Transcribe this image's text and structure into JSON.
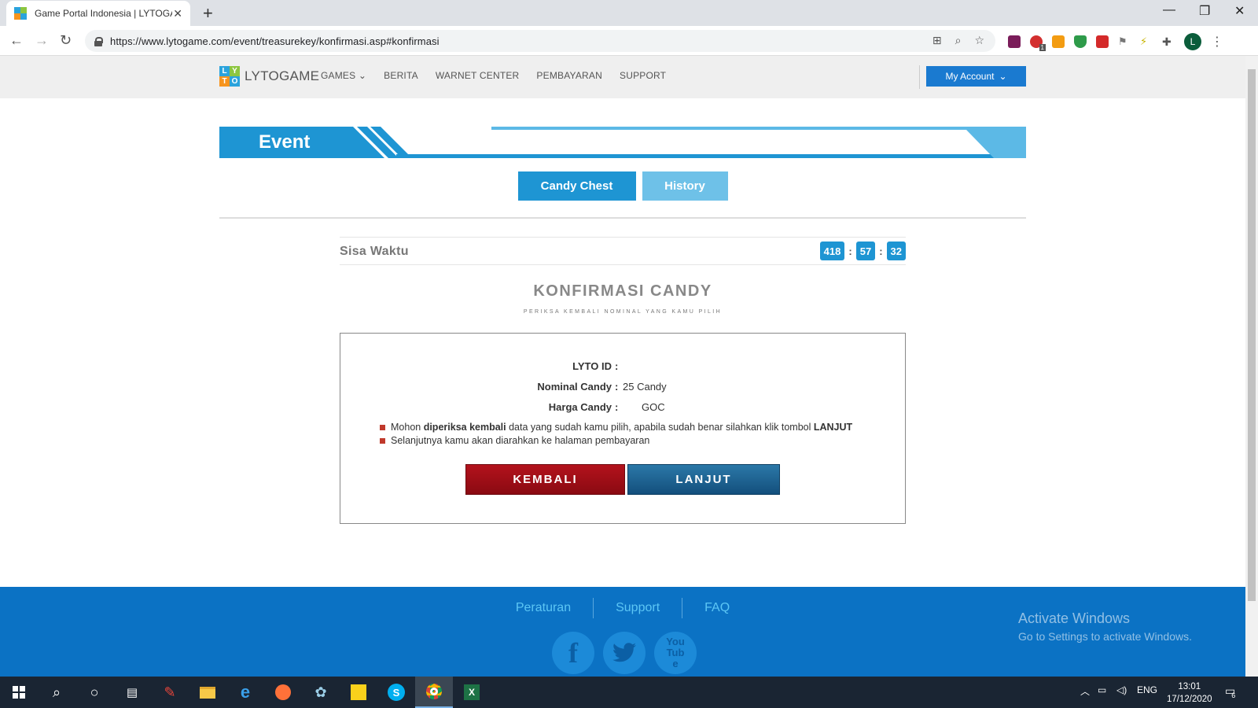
{
  "browser": {
    "tab_title": "Game Portal Indonesia | LYTOGAME",
    "url": "https://www.lytogame.com/event/treasurekey/konfirmasi.asp#konfirmasi",
    "profile_initial": "L",
    "ext_badge": "1"
  },
  "header": {
    "logo_letters": [
      "L",
      "Y",
      "T",
      "O"
    ],
    "logo_text": "LYTOGAME",
    "nav": [
      "GAMES",
      "BERITA",
      "WARNET CENTER",
      "PEMBAYARAN",
      "SUPPORT"
    ],
    "account_label": "My Account"
  },
  "event": {
    "banner_title": "Event",
    "tabs": [
      "Candy Chest",
      "History"
    ]
  },
  "timer": {
    "label": "Sisa Waktu",
    "hours": "418",
    "minutes": "57",
    "seconds": "32",
    "separator": ":"
  },
  "confirm": {
    "title": "KONFIRMASI CANDY",
    "subtitle": "PERIKSA KEMBALI NOMINAL YANG KAMU PILIH",
    "rows": [
      {
        "label": "LYTO ID",
        "value": ""
      },
      {
        "label": "Nominal Candy",
        "value": "25 Candy"
      },
      {
        "label": "Harga Candy",
        "value": "GOC"
      }
    ],
    "colon": ":",
    "note1_a": "Mohon ",
    "note1_b": "diperiksa kembali",
    "note1_c": " data yang sudah kamu pilih, apabila sudah benar silahkan klik tombol ",
    "note1_d": "LANJUT",
    "note2": "Selanjutnya kamu akan diarahkan ke halaman pembayaran",
    "btn_back": "KEMBALI",
    "btn_next": "LANJUT"
  },
  "footer": {
    "links": [
      "Peraturan",
      "Support",
      "FAQ"
    ],
    "social": [
      "facebook",
      "twitter",
      "youtube"
    ],
    "youtube_label": "YouTube",
    "activate_title": "Activate Windows",
    "activate_sub": "Go to Settings to activate Windows."
  },
  "taskbar": {
    "lang": "ENG",
    "time": "13:01",
    "date": "17/12/2020",
    "notif_count": "6"
  },
  "colors": {
    "brand_blue": "#1e95d3",
    "footer_blue": "#0b72c4",
    "kembali_red": "#a00f18",
    "lanjut_blue": "#1f6393"
  }
}
